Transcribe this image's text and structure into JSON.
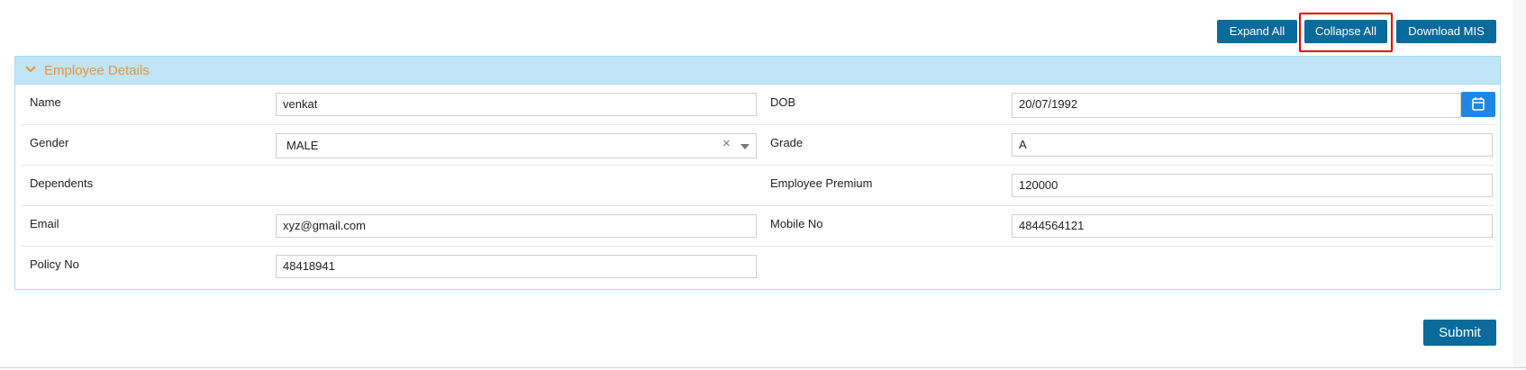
{
  "toolbar": {
    "expand_all_label": "Expand All",
    "collapse_all_label": "Collapse All",
    "download_mis_label": "Download MIS"
  },
  "panel": {
    "title": "Employee Details",
    "fields": {
      "name": {
        "label": "Name",
        "value": "venkat"
      },
      "dob": {
        "label": "DOB",
        "value": "20/07/1992"
      },
      "gender": {
        "label": "Gender",
        "value": "MALE"
      },
      "grade": {
        "label": "Grade",
        "value": "A"
      },
      "dependents": {
        "label": "Dependents"
      },
      "employee_premium": {
        "label": "Employee Premium",
        "value": "120000"
      },
      "email": {
        "label": "Email",
        "value": "xyz@gmail.com"
      },
      "mobile_no": {
        "label": "Mobile No",
        "value": "4844564121"
      },
      "policy_no": {
        "label": "Policy No",
        "value": "48418941"
      }
    }
  },
  "submit_label": "Submit",
  "icons": {
    "panel_toggle": "chevron-down-icon",
    "date_picker": "calendar-icon",
    "select_clear": "clear-x-icon",
    "select_dropdown": "caret-down-icon"
  },
  "colors": {
    "button_bg": "#0a6a9c",
    "panel_header_bg": "#bfe5f6",
    "panel_title": "#f0913a",
    "calendar_button": "#1e88e5",
    "highlight": "#e60000"
  }
}
